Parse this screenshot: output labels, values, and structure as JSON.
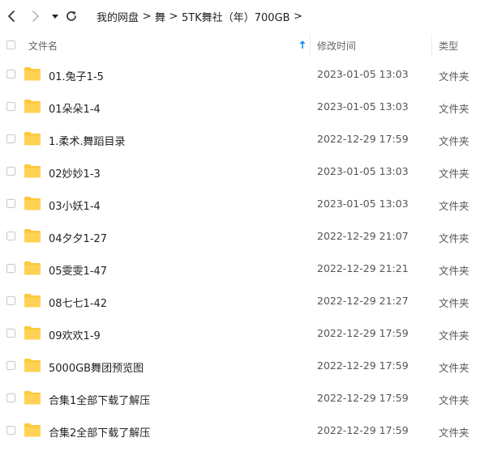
{
  "toolbar": {
    "back_icon": "chevron-left-icon",
    "forward_icon": "chevron-right-icon",
    "dropdown_icon": "caret-down-icon",
    "refresh_icon": "refresh-icon"
  },
  "breadcrumb": {
    "items": [
      "我的网盘",
      "舞",
      "5TK舞社（年）700GB"
    ],
    "separator": ">"
  },
  "header": {
    "name": "文件名",
    "modified": "修改时间",
    "type": "类型",
    "sort_icon": "sort-up-arrow-icon"
  },
  "colors": {
    "folder": "#FFC83A",
    "sort_arrow": "#1a8cff"
  },
  "files": [
    {
      "name": "01.兔子1-5",
      "modified": "2023-01-05 13:03",
      "type": "文件夹"
    },
    {
      "name": "01朵朵1-4",
      "modified": "2023-01-05 13:03",
      "type": "文件夹"
    },
    {
      "name": "1.柔术.舞蹈目录",
      "modified": "2022-12-29 17:59",
      "type": "文件夹"
    },
    {
      "name": "02妙妙1-3",
      "modified": "2023-01-05 13:03",
      "type": "文件夹"
    },
    {
      "name": "03小妖1-4",
      "modified": "2023-01-05 13:03",
      "type": "文件夹"
    },
    {
      "name": "04夕夕1-27",
      "modified": "2022-12-29 21:07",
      "type": "文件夹"
    },
    {
      "name": "05雯雯1-47",
      "modified": "2022-12-29 21:21",
      "type": "文件夹"
    },
    {
      "name": "08七七1-42",
      "modified": "2022-12-29 21:27",
      "type": "文件夹"
    },
    {
      "name": "09欢欢1-9",
      "modified": "2022-12-29 17:59",
      "type": "文件夹"
    },
    {
      "name": "5000GB舞团预览图",
      "modified": "2022-12-29 17:59",
      "type": "文件夹"
    },
    {
      "name": "合集1全部下载了解压",
      "modified": "2022-12-29 17:59",
      "type": "文件夹"
    },
    {
      "name": "合集2全部下载了解压",
      "modified": "2022-12-29 17:59",
      "type": "文件夹"
    }
  ]
}
